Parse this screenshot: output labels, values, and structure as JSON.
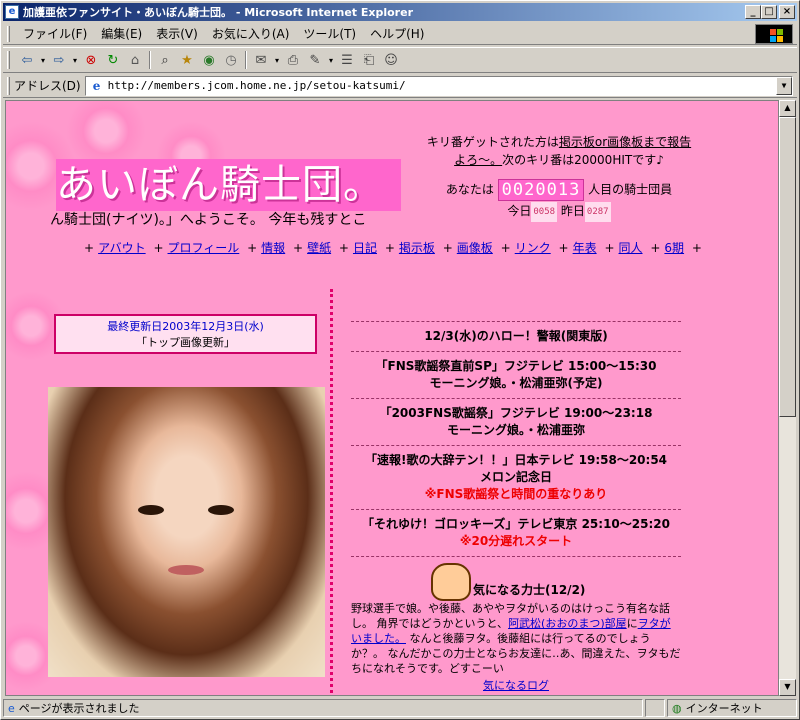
{
  "window": {
    "title": "加護亜依ファンサイト・あいぼん騎士団。 - Microsoft Internet Explorer",
    "min": "_",
    "max": "□",
    "close": "×"
  },
  "menu": [
    "ファイル(F)",
    "編集(E)",
    "表示(V)",
    "お気に入り(A)",
    "ツール(T)",
    "ヘルプ(H)"
  ],
  "address": {
    "label": "アドレス(D)",
    "url": "http://members.jcom.home.ne.jp/setou-katsumi/"
  },
  "status": {
    "text": "ページが表示されました",
    "zone": "インターネット"
  },
  "page": {
    "logo": "あいぼん騎士団。",
    "marquee": "ん騎士団(ナイツ)。」へようこそ。 今年も残すとこ",
    "kiri": {
      "line1_pre": "キリ番ゲットされた方は",
      "link": "掲示板or画像板まで報告よろ～。",
      "line_post": "次のキリ番は20000HITです♪"
    },
    "counter": {
      "pre": "あなたは",
      "value": "0020013",
      "post": "人目の騎士団員",
      "today_label": "今日",
      "today": "0058",
      "yesterday_label": "昨日",
      "yesterday": "0287"
    },
    "nav": [
      "アバウト",
      "プロフィール",
      "情報",
      "壁紙",
      "日記",
      "掲示板",
      "画像板",
      "リンク",
      "年表",
      "同人",
      "6期"
    ],
    "update": {
      "date": "最終更新日2003年12月3日(水)",
      "note": "「トップ画像更新」"
    },
    "news": [
      {
        "lines": [
          "12/3(水)のハロー！警報(関東版)"
        ],
        "red": ""
      },
      {
        "lines": [
          "「FNS歌謡祭直前SP」フジテレビ 15:00～15:30",
          "モーニング娘。・松浦亜弥(予定)"
        ],
        "red": ""
      },
      {
        "lines": [
          "「2003FNS歌謡祭」フジテレビ 19:00～23:18",
          "モーニング娘。・松浦亜弥"
        ],
        "red": ""
      },
      {
        "lines": [
          "「速報!歌の大辞テン！！」日本テレビ 19:58～20:54",
          "メロン記念日"
        ],
        "red": "※FNS歌謡祭と時間の重なりあり"
      },
      {
        "lines": [
          "「それゆけ！ゴロッキーズ」テレビ東京 25:10～25:20"
        ],
        "red": "※20分遅れスタート"
      }
    ],
    "kininaru": {
      "title": "気になる力士(12/2)",
      "body1": "野球選手で娘。や後藤、あややヲタがいるのはけっこう有名な話し。 角界ではどうかというと、",
      "link1": "阿武松(おおのまつ)部屋",
      "body2": "に",
      "link2": "ヲタがいました。",
      "body3": " なんと後藤ヲタ。後藤組には行ってるのでしょうか？。 なんだかこの力士とならお友達に‥あ、間違えた、ヲタもだちになれそうです。どすこーい",
      "log": "気になるログ"
    }
  }
}
